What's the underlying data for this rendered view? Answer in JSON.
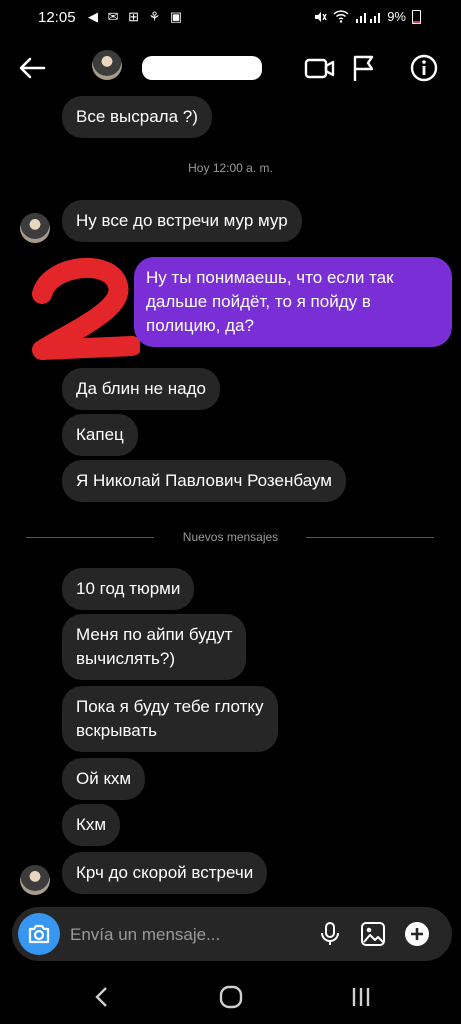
{
  "status": {
    "time": "12:05",
    "battery": "9%",
    "left_icons": "◀ ✉ ⊞ ⚘ ▣"
  },
  "header": {
    "contact_name_redacted": ""
  },
  "messages": [
    {
      "text": "Все высрала ?)",
      "side": "received"
    },
    {
      "text": "Ну все до встречи мур мур",
      "side": "received"
    },
    {
      "text": "Ну ты понимаешь, что если так\nдальше пойдёт, то я пойду в\nполицию, да?",
      "side": "sent"
    },
    {
      "text": "Да блин не надо",
      "side": "received"
    },
    {
      "text": "Капец",
      "side": "received"
    },
    {
      "text": "Я Николай Павлович Розенбаум",
      "side": "received"
    },
    {
      "text": "10 год тюрми",
      "side": "received"
    },
    {
      "text": "Меня по айпи будут\nвычислять?)",
      "side": "received"
    },
    {
      "text": "Пока я буду тебе глотку\nвскрывать",
      "side": "received"
    },
    {
      "text": "Ой кхм",
      "side": "received"
    },
    {
      "text": "Кхм",
      "side": "received"
    },
    {
      "text": "Крч до скорой встречи",
      "side": "received"
    }
  ],
  "timestamp": "Hoy 12:00 a. m.",
  "new_messages_divider": "Nuevos mensajes",
  "annotation": {
    "label": "2",
    "color": "#e3262a"
  },
  "composer": {
    "placeholder": "Envía un mensaje..."
  },
  "colors": {
    "accent": "#3797f0",
    "sent_bubble": "#7a2fd6",
    "received_bubble": "#262626"
  }
}
